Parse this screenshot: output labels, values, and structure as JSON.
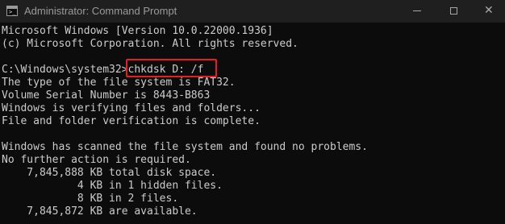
{
  "window": {
    "title": "Administrator: Command Prompt",
    "icon": "cmd-icon",
    "controls": {
      "minimize_icon": "minimize-icon",
      "maximize_icon": "maximize-icon",
      "close_icon": "close-icon",
      "close_glyph": "✕"
    }
  },
  "console": {
    "lines": [
      "Microsoft Windows [Version 10.0.22000.1936]",
      "(c) Microsoft Corporation. All rights reserved.",
      "",
      "C:\\Windows\\system32>chkdsk D: /f",
      "The type of the file system is FAT32.",
      "Volume Serial Number is 8443-B863",
      "Windows is verifying files and folders...",
      "File and folder verification is complete.",
      "",
      "Windows has scanned the file system and found no problems.",
      "No further action is required.",
      "    7,845,888 KB total disk space.",
      "            4 KB in 1 hidden files.",
      "            8 KB in 2 files.",
      "    7,845,872 KB are available."
    ],
    "highlighted_command": "chkdsk D: /f",
    "highlight_color": "#e81c23",
    "text_color": "#cccccc",
    "background_color": "#0c0c0c"
  }
}
